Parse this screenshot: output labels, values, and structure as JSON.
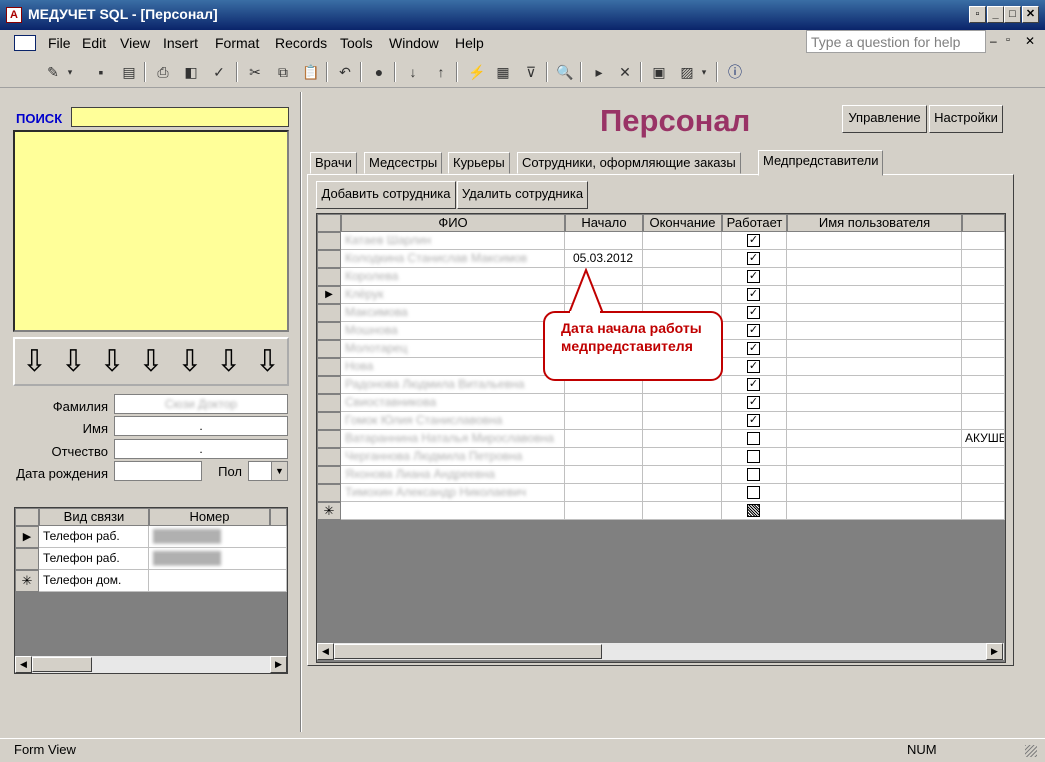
{
  "window": {
    "title": "МЕДУЧЕТ SQL - [Персонал]",
    "app_icon": "access-form-icon"
  },
  "menu": {
    "items": [
      "File",
      "Edit",
      "View",
      "Insert",
      "Format",
      "Records",
      "Tools",
      "Window",
      "Help"
    ],
    "ask_placeholder": "Type a question for help"
  },
  "left": {
    "search_label": "ПОИСК",
    "fields": {
      "surname_label": "Фамилия",
      "name_label": "Имя",
      "patronymic_label": "Отчество",
      "birthdate_label": "Дата рождения",
      "sex_label": "Пол",
      "surname_value": "Сюзи Доктор",
      "name_value": ".",
      "patronymic_value": "."
    },
    "contacts": {
      "headers": [
        "Вид связи",
        "Номер"
      ],
      "rows": [
        {
          "type": "Телефон раб.",
          "number": "████████"
        },
        {
          "type": "Телефон раб.",
          "number": "████████"
        },
        {
          "type": "Телефон дом.",
          "number": ""
        }
      ]
    }
  },
  "page": {
    "title": "Персонал",
    "btn_manage": "Управление",
    "btn_settings": "Настройки"
  },
  "tabs": [
    "Врачи",
    "Медсестры",
    "Курьеры",
    "Сотрудники, оформляющие заказы",
    "Медпредставители"
  ],
  "active_tab": 4,
  "actions": {
    "add": "Добавить сотрудника",
    "delete": "Удалить сотрудника"
  },
  "grid": {
    "headers": [
      "ФИО",
      "Начало",
      "Окончание",
      "Работает",
      "Имя пользователя"
    ],
    "rows": [
      {
        "fio": "Катаев Шарлин",
        "start": "",
        "end": "",
        "works": true,
        "user": ""
      },
      {
        "fio": "Колодкина Станислав Максимов",
        "start": "05.03.2012",
        "end": "",
        "works": true,
        "user": ""
      },
      {
        "fio": "Королева",
        "start": "",
        "end": "",
        "works": true,
        "user": ""
      },
      {
        "fio": "Клёрук",
        "start": "",
        "end": "",
        "works": true,
        "user": ""
      },
      {
        "fio": "Максимова",
        "start": "",
        "end": "",
        "works": true,
        "user": ""
      },
      {
        "fio": "Мошнова",
        "start": "",
        "end": "",
        "works": true,
        "user": ""
      },
      {
        "fio": "Молотарец",
        "start": "",
        "end": "",
        "works": true,
        "user": ""
      },
      {
        "fio": "Нова",
        "start": "",
        "end": "",
        "works": true,
        "user": ""
      },
      {
        "fio": "Радонова Людмила Витальевна",
        "start": "",
        "end": "",
        "works": true,
        "user": ""
      },
      {
        "fio": "Свиоставникова",
        "start": "",
        "end": "",
        "works": true,
        "user": ""
      },
      {
        "fio": "Гомок Юлия Станиславовна",
        "start": "",
        "end": "",
        "works": true,
        "user": ""
      },
      {
        "fio": "Ватараннина Наталья Мирославовна",
        "start": "",
        "end": "",
        "works": false,
        "user": "АКУШЕ"
      },
      {
        "fio": "Черганнова Людмила Петровна",
        "start": "",
        "end": "",
        "works": false,
        "user": ""
      },
      {
        "fio": "Яхонова Лиана Андреевна",
        "start": "",
        "end": "",
        "works": false,
        "user": ""
      },
      {
        "fio": "Тимохин Александр Николаевич",
        "start": "",
        "end": "",
        "works": false,
        "user": ""
      }
    ]
  },
  "callout": "Дата начала работы медпредставителя",
  "status": {
    "left": "Form View",
    "right": "NUM"
  }
}
